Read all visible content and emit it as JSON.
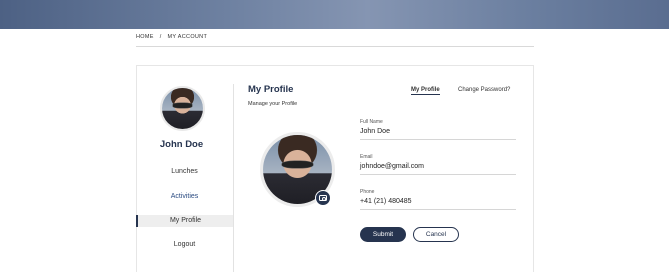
{
  "breadcrumb": {
    "home": "HOME",
    "separator": "/",
    "current": "MY ACCOUNT"
  },
  "sidebar": {
    "user_name": "John Doe",
    "items": [
      {
        "label": "Lunches",
        "state": "normal"
      },
      {
        "label": "Activities",
        "state": "highlighted"
      },
      {
        "label": "My Profile",
        "state": "selected"
      },
      {
        "label": "Logout",
        "state": "normal"
      }
    ]
  },
  "profile": {
    "title": "My Profile",
    "subtitle": "Manage your Profile",
    "tabs": [
      {
        "label": "My Profile",
        "active": true
      },
      {
        "label": "Change Password?",
        "active": false
      }
    ],
    "fields": [
      {
        "label": "Full Name",
        "value": "John Doe"
      },
      {
        "label": "Email",
        "value": "johndoe@gmail.com"
      },
      {
        "label": "Phone",
        "value": "+41 (21) 480485"
      }
    ],
    "submit_label": "Submit",
    "cancel_label": "Cancel",
    "camera_icon": "camera-icon"
  },
  "colors": {
    "primary": "#26344f",
    "accent_link": "#2c4c82",
    "banner": "#6f82a2"
  }
}
